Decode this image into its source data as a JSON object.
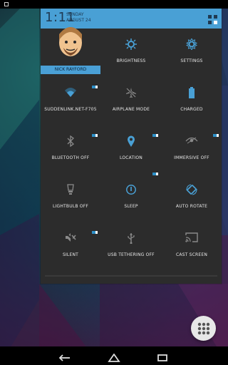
{
  "header": {
    "time": "1:11",
    "day": "SUNDAY",
    "date": "AUGUST 24"
  },
  "user": {
    "name": "NICK RAYFORD"
  },
  "tiles": [
    {
      "label": "BRIGHTNESS",
      "icon": "brightness-icon"
    },
    {
      "label": "SETTINGS",
      "icon": "gear-icon"
    },
    {
      "label": "SUDDENLINK.NET-F705",
      "icon": "wifi-icon"
    },
    {
      "label": "AIRPLANE MODE",
      "icon": "airplane-icon"
    },
    {
      "label": "CHARGED",
      "icon": "battery-icon"
    },
    {
      "label": "BLUETOOTH OFF",
      "icon": "bluetooth-icon"
    },
    {
      "label": "LOCATION",
      "icon": "location-pin-icon"
    },
    {
      "label": "IMMERSIVE OFF",
      "icon": "immersive-icon"
    },
    {
      "label": "LIGHTBULB OFF",
      "icon": "lightbulb-icon"
    },
    {
      "label": "SLEEP",
      "icon": "power-icon"
    },
    {
      "label": "AUTO ROTATE",
      "icon": "rotate-icon"
    },
    {
      "label": "SILENT",
      "icon": "mute-icon"
    },
    {
      "label": "USB TETHERING OFF",
      "icon": "usb-icon"
    },
    {
      "label": "CAST SCREEN",
      "icon": "cast-icon"
    }
  ],
  "colors": {
    "accent": "#49a0d5",
    "panel": "#2c2c2c",
    "tile_text": "#e8e8e8"
  }
}
